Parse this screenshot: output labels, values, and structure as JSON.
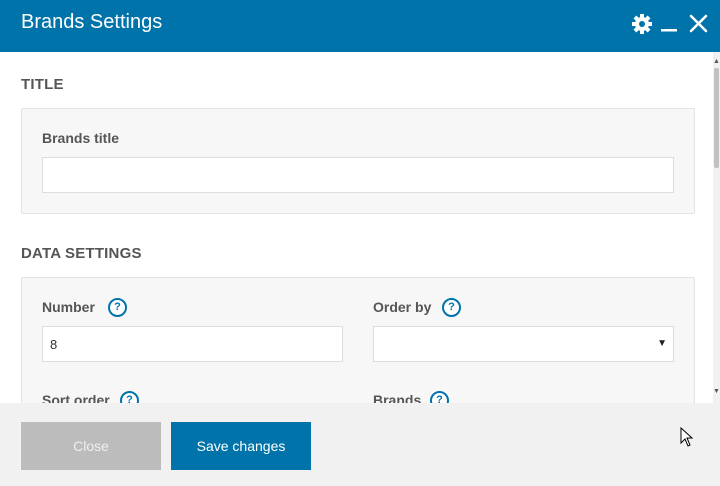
{
  "window": {
    "title": "Brands Settings",
    "icons": [
      "gear-icon",
      "minimize-icon",
      "close-icon"
    ],
    "accent_color": "#0073aa"
  },
  "sections": {
    "title_section": {
      "heading": "TITLE",
      "brands_title": {
        "label": "Brands title",
        "value": "",
        "placeholder": ""
      }
    },
    "data_settings": {
      "heading": "DATA SETTINGS",
      "number": {
        "label": "Number",
        "value": "8",
        "help": "?"
      },
      "order_by": {
        "label": "Order by",
        "value": "",
        "help": "?"
      },
      "sort_order": {
        "label": "Sort order",
        "help": "?"
      },
      "brands": {
        "label": "Brands",
        "help": "?"
      }
    }
  },
  "footer": {
    "close_label": "Close",
    "save_label": "Save changes"
  }
}
